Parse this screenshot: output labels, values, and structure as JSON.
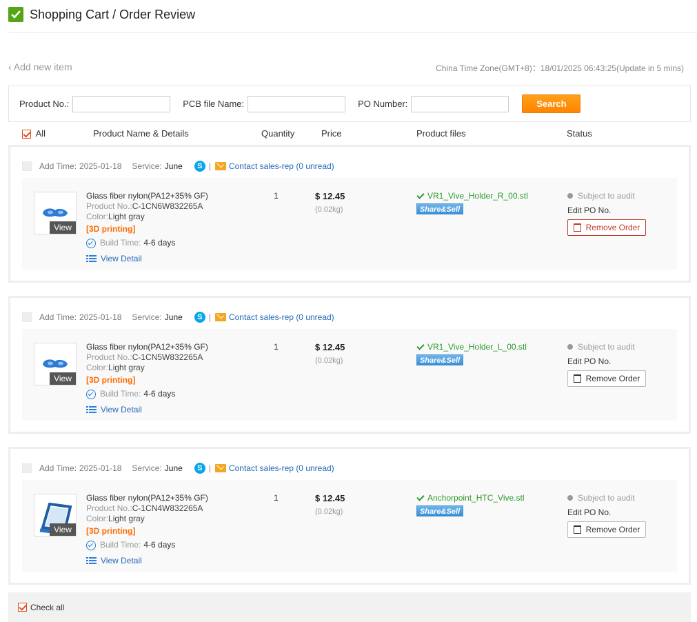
{
  "header": {
    "title": "Shopping Cart / Order Review"
  },
  "toolbar": {
    "add_item": "‹ Add new item",
    "timezone": "China Time Zone(GMT+8)：18/01/2025 06:43:25(Update in 5 mins)"
  },
  "search": {
    "product_no_label": "Product No.:",
    "pcb_label": "PCB file Name:",
    "po_label": "PO Number:",
    "button": "Search"
  },
  "columns": {
    "all": "All",
    "details": "Product Name & Details",
    "quantity": "Quantity",
    "price": "Price",
    "files": "Product files",
    "status": "Status"
  },
  "labels": {
    "add_time": "Add Time:",
    "service": "Service:",
    "contact": "Contact sales-rep (0 unread)",
    "product_no": "Product No.:",
    "color": "Color:",
    "build_time": "Build Time:",
    "view_detail": "View Detail",
    "view": "View",
    "share": "Share&Sell",
    "edit_po": "Edit PO No.",
    "remove": "Remove Order",
    "separator": "|"
  },
  "orders": [
    {
      "add_time": "2025-01-18",
      "service": "June",
      "name": "Glass fiber nylon(PA12+35% GF)",
      "product_no": "C-1CN6W832265A",
      "color": "Light gray",
      "tag": "[3D printing]",
      "build_time": "4-6 days",
      "quantity": "1",
      "price": "$ 12.45",
      "weight": "(0.02kg)",
      "file": "VR1_Vive_Holder_R_00.stl",
      "status": "Subject to audit"
    },
    {
      "add_time": "2025-01-18",
      "service": "June",
      "name": "Glass fiber nylon(PA12+35% GF)",
      "product_no": "C-1CN5W832265A",
      "color": "Light gray",
      "tag": "[3D printing]",
      "build_time": "4-6 days",
      "quantity": "1",
      "price": "$ 12.45",
      "weight": "(0.02kg)",
      "file": "VR1_Vive_Holder_L_00.stl",
      "status": "Subject to audit"
    },
    {
      "add_time": "2025-01-18",
      "service": "June",
      "name": "Glass fiber nylon(PA12+35% GF)",
      "product_no": "C-1CN4W832265A",
      "color": "Light gray",
      "tag": "[3D printing]",
      "build_time": "4-6 days",
      "quantity": "1",
      "price": "$ 12.45",
      "weight": "(0.02kg)",
      "file": "Anchorpoint_HTC_Vive.stl",
      "status": "Subject to audit"
    }
  ],
  "footer": {
    "check_all": "Check all"
  },
  "colors": {
    "accent": "#ff8a00",
    "link": "#2268b8",
    "success": "#2a9a2a",
    "danger": "#c0392b",
    "check": "#52a515"
  }
}
